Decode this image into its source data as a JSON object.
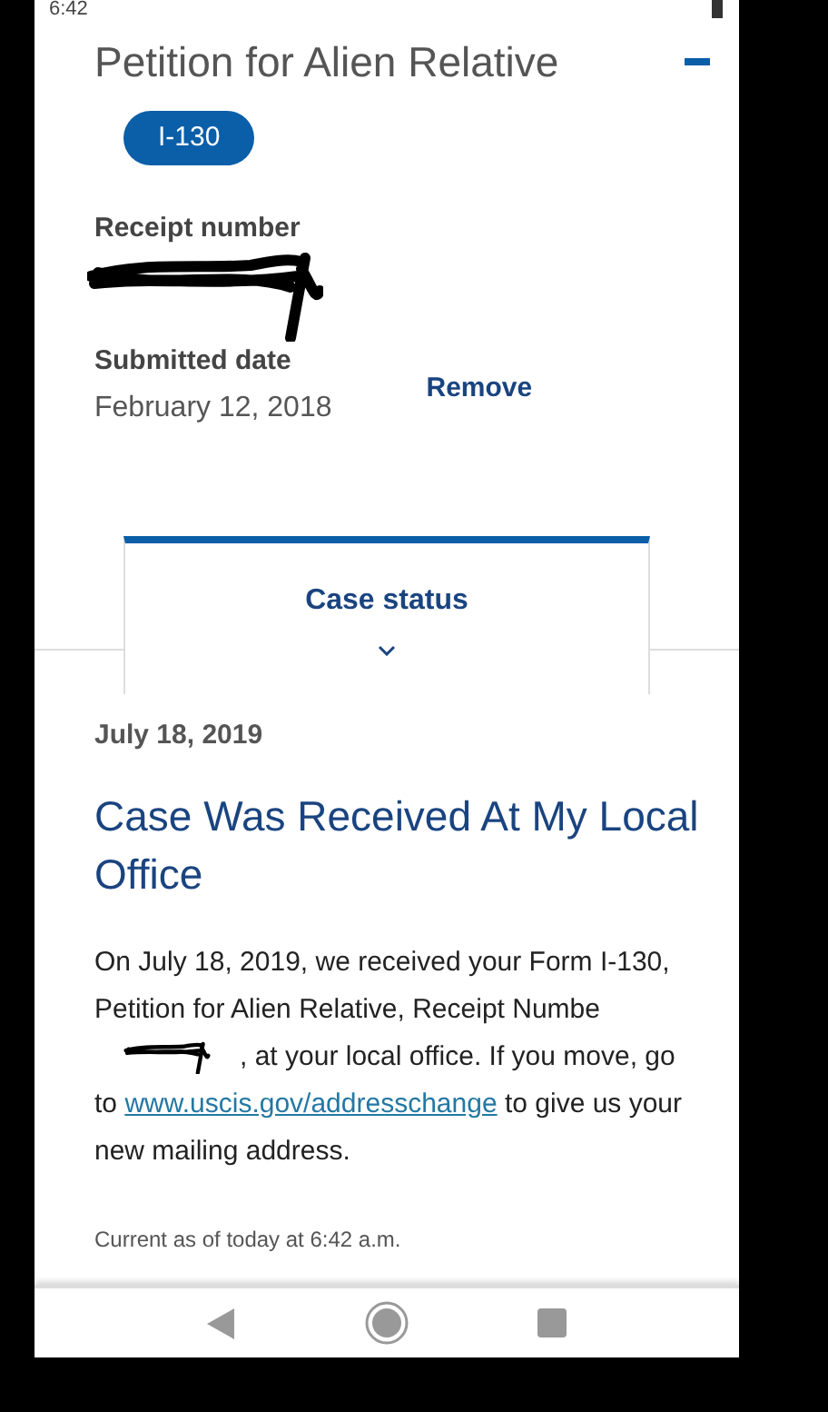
{
  "status_bar": {
    "time": "6:42"
  },
  "case": {
    "title": "Petition for Alien Relative",
    "form_badge": "I-130",
    "receipt_label": "Receipt number",
    "submitted_label": "Submitted date",
    "submitted_value": "February 12, 2018",
    "remove_link": "Remove"
  },
  "tab": {
    "label": "Case status"
  },
  "status": {
    "date": "July 18, 2019",
    "heading": "Case Was Received At My Local Office",
    "message_before": "On July 18, 2019, we received your Form I-130, Petition for Alien Relative, Receipt Numbe",
    "message_middle": ", at your local office. If you move, go to ",
    "link": "www.uscis.gov/addresschange",
    "message_after": " to give us your new mailing address.",
    "updated": "Current as of today at 6:42 a.m."
  }
}
